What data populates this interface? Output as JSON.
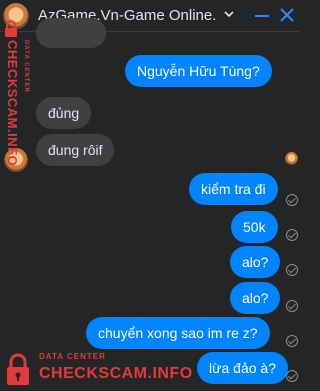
{
  "header": {
    "title": "AzGame.Vn-Game Online.",
    "icons": [
      "avatar",
      "chevron-down-icon",
      "minimize-icon",
      "close-icon"
    ],
    "accent_color": "#2d88ff"
  },
  "messages": [
    {
      "side": "out",
      "text": "Nguyễn Hữu Tùng?"
    },
    {
      "side": "in",
      "text": "đủng"
    },
    {
      "side": "in",
      "text": "đung rôif"
    },
    {
      "side": "out",
      "text": "kiểm tra đi"
    },
    {
      "side": "out",
      "text": "50k"
    },
    {
      "side": "out",
      "text": "alo?"
    },
    {
      "side": "out",
      "text": "alo?"
    },
    {
      "side": "out",
      "text": "chuyển xong sao im re z?"
    },
    {
      "side": "out",
      "text": "lừa đảo à?"
    }
  ],
  "watermark": {
    "top": "DATA CENTER",
    "brand": "CHECKSCAM.INFO"
  },
  "colors": {
    "background": "#242526",
    "incoming_bubble": "#3e4042",
    "outgoing_bubble": "#0084ff",
    "watermark": "#e23b3b"
  }
}
